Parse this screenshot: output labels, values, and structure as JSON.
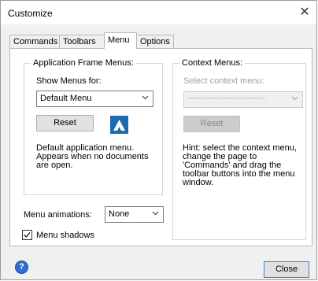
{
  "window": {
    "title": "Customize",
    "close_glyph": "✕"
  },
  "tabs": [
    {
      "label": "Commands"
    },
    {
      "label": "Toolbars"
    },
    {
      "label": "Menu"
    },
    {
      "label": "Options"
    }
  ],
  "active_tab": "Menu",
  "app_frame": {
    "title": "Application Frame Menus:",
    "show_menus_label": "Show Menus for:",
    "show_menus_value": "Default Menu",
    "reset_label": "Reset",
    "description": "Default application menu. Appears when no documents are open."
  },
  "context": {
    "title": "Context Menus:",
    "select_label": "Select context menu:",
    "select_value": "——————————————",
    "reset_label": "Reset",
    "hint": "Hint: select the context menu, change the page to 'Commands' and drag the toolbar buttons into the menu window."
  },
  "animations": {
    "label": "Menu animations:",
    "value": "None"
  },
  "shadows": {
    "label": "Menu shadows",
    "checked": true
  },
  "footer": {
    "help_glyph": "?",
    "close_label": "Close"
  },
  "colors": {
    "accent": "#3c7fd1",
    "logo": "#1f69b3",
    "disabled_text": "#a0a0a0"
  }
}
